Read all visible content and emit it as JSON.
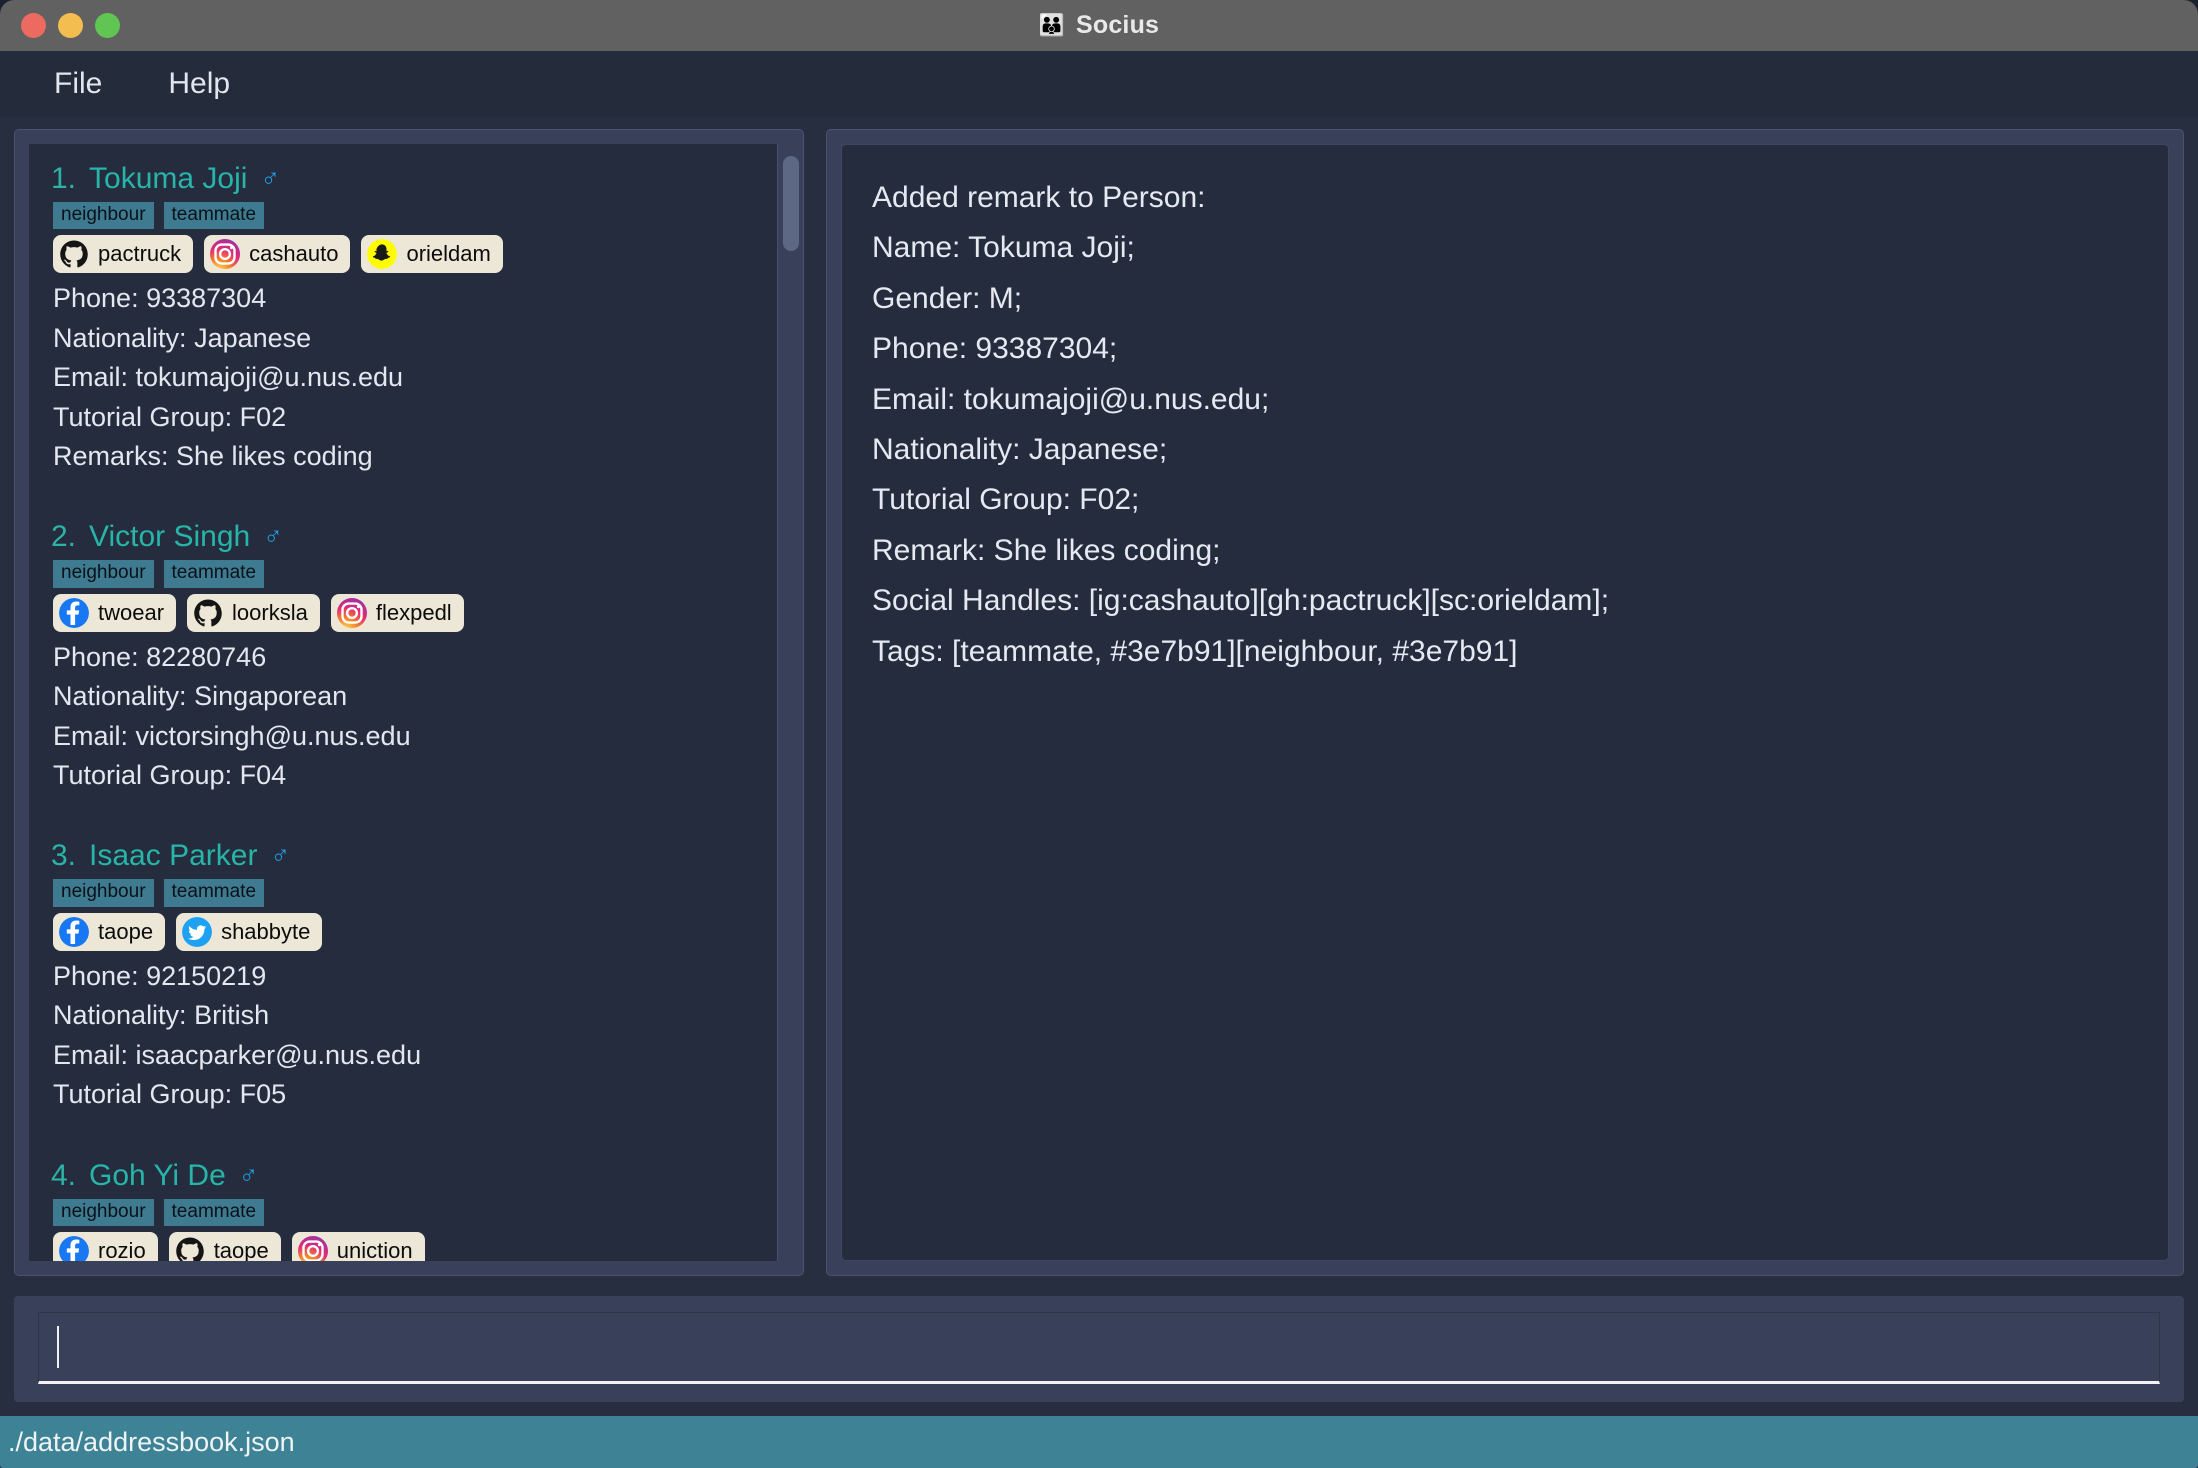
{
  "window": {
    "title": "Socius",
    "title_icon": "people-emoji",
    "traffic_lights": [
      "close",
      "minimize",
      "maximize"
    ]
  },
  "menubar": {
    "items": [
      {
        "label": "File",
        "name": "menu-file"
      },
      {
        "label": "Help",
        "name": "menu-help"
      }
    ]
  },
  "colors": {
    "tag_color": "#3e7b91",
    "accent_name": "#27b5a9",
    "gender_icon": "#1f9ee0",
    "status_bar": "#3e8395",
    "handle_chip": "#ece7d7"
  },
  "person_list": [
    {
      "index": "1.",
      "name": "Tokuma Joji",
      "gender_symbol": "♂",
      "tags": [
        "neighbour",
        "teammate"
      ],
      "handles": [
        {
          "platform": "github",
          "handle": "pactruck"
        },
        {
          "platform": "instagram",
          "handle": "cashauto"
        },
        {
          "platform": "snapchat",
          "handle": "orieldam"
        }
      ],
      "fields": [
        "Phone: 93387304",
        "Nationality: Japanese",
        "Email: tokumajoji@u.nus.edu",
        "Tutorial Group: F02",
        "Remarks: She likes coding"
      ]
    },
    {
      "index": "2.",
      "name": "Victor Singh",
      "gender_symbol": "♂",
      "tags": [
        "neighbour",
        "teammate"
      ],
      "handles": [
        {
          "platform": "facebook",
          "handle": "twoear"
        },
        {
          "platform": "github",
          "handle": "loorksla"
        },
        {
          "platform": "instagram",
          "handle": "flexpedl"
        }
      ],
      "fields": [
        "Phone: 82280746",
        "Nationality: Singaporean",
        "Email: victorsingh@u.nus.edu",
        "Tutorial Group: F04"
      ]
    },
    {
      "index": "3.",
      "name": "Isaac Parker",
      "gender_symbol": "♂",
      "tags": [
        "neighbour",
        "teammate"
      ],
      "handles": [
        {
          "platform": "facebook",
          "handle": "taope"
        },
        {
          "platform": "twitter",
          "handle": "shabbyte"
        }
      ],
      "fields": [
        "Phone: 92150219",
        "Nationality: British",
        "Email: isaacparker@u.nus.edu",
        "Tutorial Group: F05"
      ]
    },
    {
      "index": "4.",
      "name": "Goh Yi De",
      "gender_symbol": "♂",
      "tags": [
        "neighbour",
        "teammate"
      ],
      "handles": [
        {
          "platform": "facebook",
          "handle": "rozio"
        },
        {
          "platform": "github",
          "handle": "taope"
        },
        {
          "platform": "instagram",
          "handle": "uniction"
        }
      ],
      "fields": []
    }
  ],
  "result": {
    "lines": [
      "Added remark to Person:",
      "Name: Tokuma Joji;",
      "Gender: M;",
      "Phone: 93387304;",
      "Email: tokumajoji@u.nus.edu;",
      "Nationality: Japanese;",
      "Tutorial Group: F02;",
      "Remark: She likes coding;",
      "Social Handles: [ig:cashauto][gh:pactruck][sc:orieldam];",
      "Tags: [teammate, #3e7b91][neighbour, #3e7b91]"
    ]
  },
  "command_box": {
    "value": "",
    "placeholder": ""
  },
  "statusbar": {
    "path": "./data/addressbook.json"
  }
}
